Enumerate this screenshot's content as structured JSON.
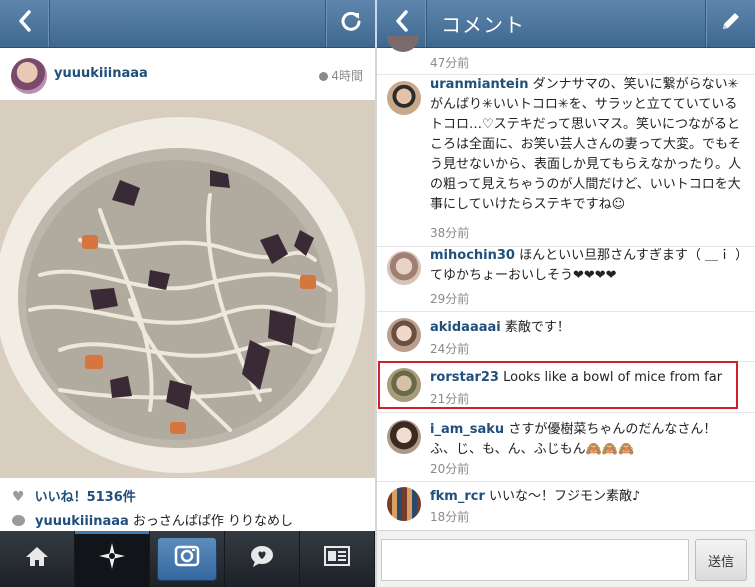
{
  "left": {
    "post": {
      "username": "yuuukiiinaaa",
      "time": "4時間"
    },
    "likes": "いいね！5136件",
    "caption": {
      "username": "yuuukiiinaaa",
      "text": "おっさんぱぱ作 りりなめし"
    },
    "bottom_tabs": [
      "home",
      "explore",
      "camera",
      "news",
      "profile"
    ]
  },
  "right": {
    "title": "コメント",
    "top_partial_time": "47分前",
    "comments": [
      {
        "username": "uranmiantein",
        "text": "ダンナサマの、笑いに繋がらない✳︎がんばり✳︎いいトコロ✳︎を、サラッと立てていているトコロ…♡ステキだって思いマス。笑いにつながるところは全面に、お笑い芸人さんの妻って大変。でもそう見せないから、表面しか見てもらえなかったり。人の粗って見えちゃうのが人間だけど、いいトコロを大事にしていけたらステキですね☺",
        "time": "38分前"
      },
      {
        "username": "mihochin30",
        "text": "ほんといい旦那さんすぎます（ ＿ｉ ）てゆかちょーおいしそう❤︎❤︎❤︎❤︎",
        "time": "29分前"
      },
      {
        "username": "akidaaaai",
        "text": "素敵です！",
        "time": "24分前"
      },
      {
        "username": "rorstar23",
        "text": "Looks like a bowl of mice from far",
        "time": "21分前"
      },
      {
        "username": "i_am_saku",
        "text": "さすが優樹菜ちゃんのだんなさん！ふ、じ、も、ん、ふじもん🙈🙈🙈",
        "time": "20分前"
      },
      {
        "username": "fkm_rcr",
        "text": "いいな〜！フジモン素敵♪",
        "time": "18分前"
      }
    ],
    "input_placeholder": "",
    "send_label": "送信"
  },
  "colors": {
    "nav_blue": "#4a739b",
    "link_blue": "#1f4f7a",
    "highlight_red": "#d0202a"
  },
  "icons": {
    "back": "chevron-left-icon",
    "refresh": "refresh-icon",
    "compose": "pencil-icon"
  }
}
